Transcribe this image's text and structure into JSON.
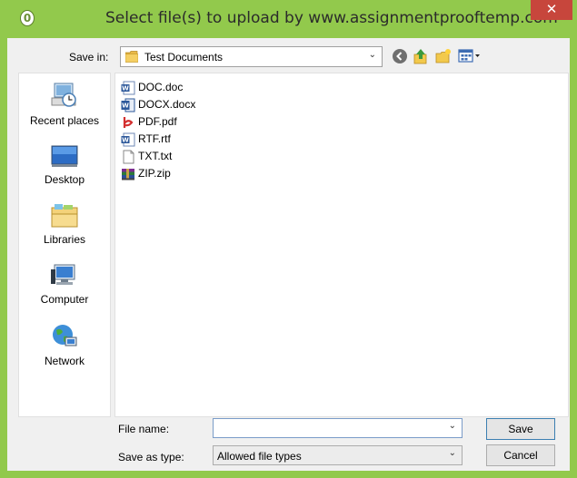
{
  "window": {
    "title": "Select file(s) to upload by www.assignmentprooftemp.com",
    "close_glyph": "✕",
    "app_icon_glyph": "0"
  },
  "toolbar": {
    "save_in_label": "Save in:",
    "current_folder": "Test Documents",
    "icons": [
      "back-icon",
      "up-folder-icon",
      "new-folder-icon",
      "view-menu-icon"
    ]
  },
  "places": [
    {
      "label": "Recent places",
      "icon": "recent-places-icon"
    },
    {
      "label": "Desktop",
      "icon": "desktop-icon"
    },
    {
      "label": "Libraries",
      "icon": "libraries-icon"
    },
    {
      "label": "Computer",
      "icon": "computer-icon"
    },
    {
      "label": "Network",
      "icon": "network-icon"
    }
  ],
  "files": [
    {
      "name": "DOC.doc",
      "icon": "word-doc-icon"
    },
    {
      "name": "DOCX.docx",
      "icon": "word-docx-icon"
    },
    {
      "name": "PDF.pdf",
      "icon": "pdf-icon"
    },
    {
      "name": "RTF.rtf",
      "icon": "rtf-icon"
    },
    {
      "name": "TXT.txt",
      "icon": "text-file-icon"
    },
    {
      "name": "ZIP.zip",
      "icon": "zip-archive-icon"
    }
  ],
  "bottom": {
    "file_name_label": "File name:",
    "file_name_value": "",
    "save_as_type_label": "Save as type:",
    "save_as_type_value": "Allowed file types",
    "save_button": "Save",
    "cancel_button": "Cancel"
  },
  "colors": {
    "title_bar": "#92c94c",
    "close_button": "#c7463c",
    "dialog_background": "#f0f0f0"
  }
}
